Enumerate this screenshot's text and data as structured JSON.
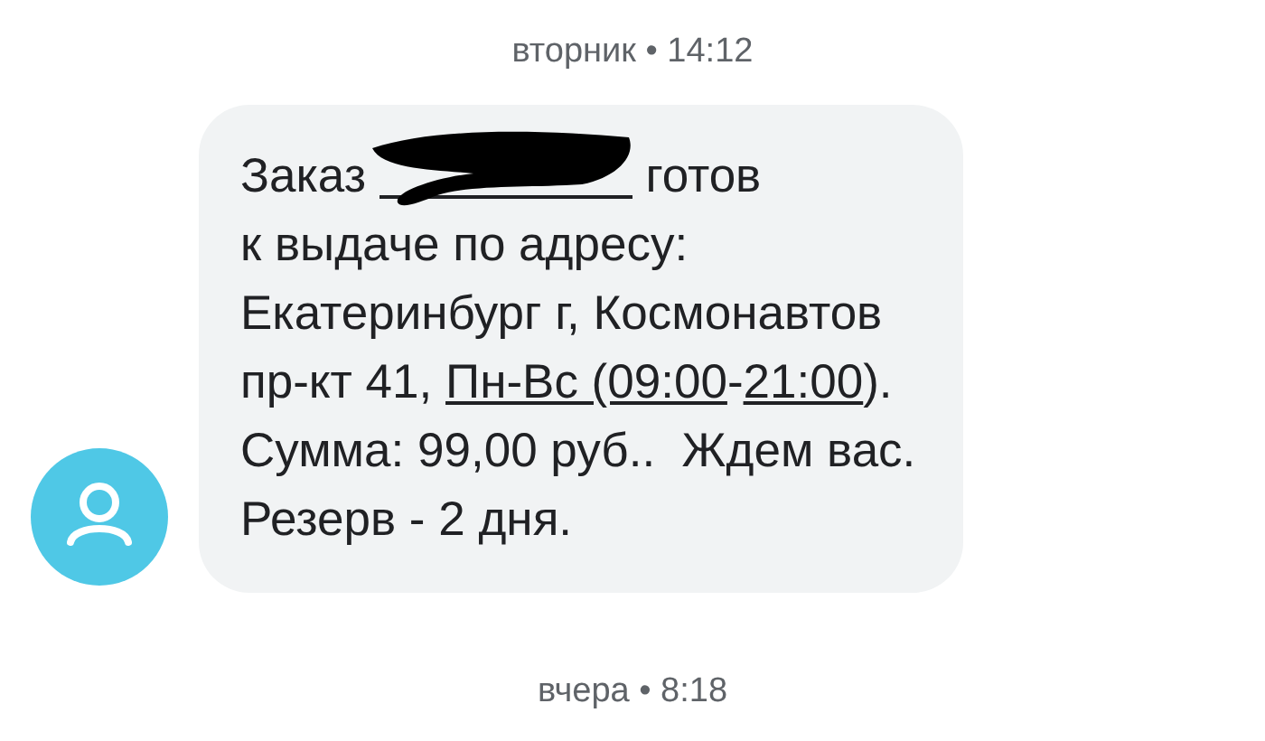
{
  "timestamps": [
    "вторник • 14:12",
    "вчера • 8:18"
  ],
  "message": {
    "lines": [
      [
        {
          "kind": "text",
          "text": "Заказ "
        },
        {
          "kind": "redacted"
        },
        {
          "kind": "text",
          "text": " готов"
        }
      ],
      [
        {
          "kind": "text",
          "text": "к выдаче по адресу:"
        }
      ],
      [
        {
          "kind": "text",
          "text": "Екатеринбург г, Космонавтов"
        }
      ],
      [
        {
          "kind": "text",
          "text": "пр-кт 41, "
        },
        {
          "kind": "link",
          "text": "Пн-Вс (09:00"
        },
        {
          "kind": "text",
          "text": "-"
        },
        {
          "kind": "link",
          "text": "21:00"
        },
        {
          "kind": "text",
          "text": ")."
        }
      ],
      [
        {
          "kind": "text",
          "text": "Сумма: 99,00 руб..  Ждем вас."
        }
      ],
      [
        {
          "kind": "text",
          "text": "Резерв - 2 дня."
        }
      ]
    ]
  }
}
